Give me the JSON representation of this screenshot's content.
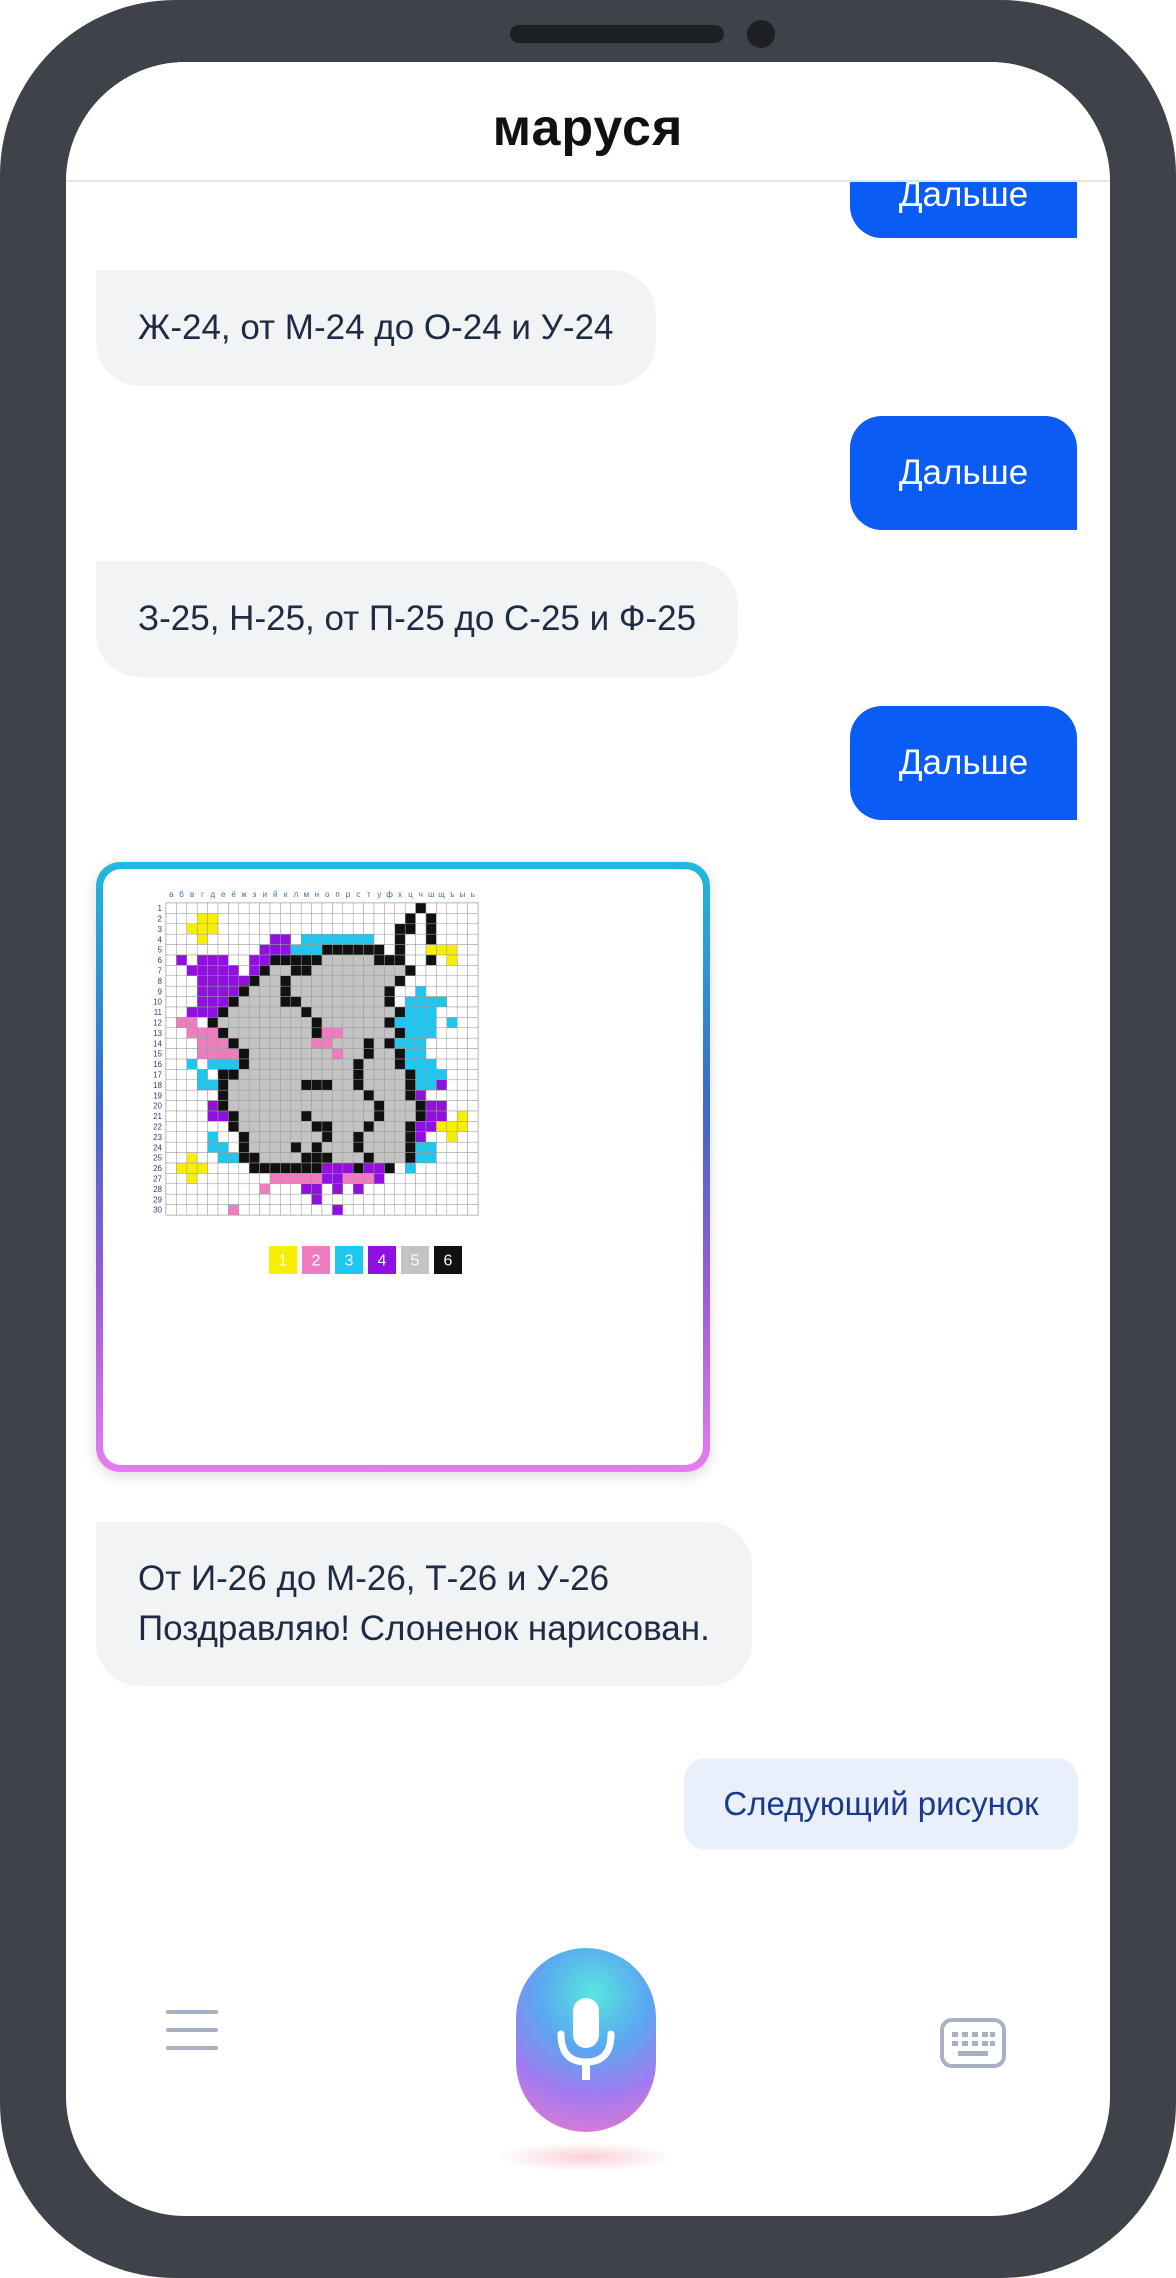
{
  "app": {
    "title": "маруся"
  },
  "messages": [
    {
      "from": "user",
      "text": "Дальше"
    },
    {
      "from": "assistant",
      "text": "Ж-24, от М-24 до О-24 и У-24"
    },
    {
      "from": "user",
      "text": "Дальше"
    },
    {
      "from": "assistant",
      "text": "З-25, Н-25, от П-25 до С-25 и Ф-25"
    },
    {
      "from": "user",
      "text": "Дальше"
    },
    {
      "from": "assistant",
      "lines": [
        "От И-26 до М-26, Т-26 и У-26",
        "Поздравляю! Слоненок нарисован."
      ]
    }
  ],
  "picture": {
    "column_letters": [
      "а",
      "б",
      "в",
      "г",
      "д",
      "е",
      "ё",
      "ж",
      "з",
      "и",
      "й",
      "к",
      "л",
      "м",
      "н",
      "о",
      "п",
      "р",
      "с",
      "т",
      "у",
      "ф",
      "х",
      "ц",
      "ч",
      "ш",
      "щ",
      "ъ",
      "ы",
      "ь"
    ],
    "row_numbers": [
      "1",
      "2",
      "3",
      "4",
      "5",
      "6",
      "7",
      "8",
      "9",
      "10",
      "11",
      "12",
      "13",
      "14",
      "15",
      "16",
      "17",
      "18",
      "19",
      "20",
      "21",
      "22",
      "23",
      "24",
      "25",
      "26",
      "27",
      "28",
      "29",
      "30"
    ],
    "palette": [
      {
        "label": "1",
        "color": "#f7ee00"
      },
      {
        "label": "2",
        "color": "#f07cc0"
      },
      {
        "label": "3",
        "color": "#1fc6ee"
      },
      {
        "label": "4",
        "color": "#9010e0"
      },
      {
        "label": "5",
        "color": "#c3c3c3"
      },
      {
        "label": "6",
        "color": "#111111"
      }
    ]
  },
  "suggestion": {
    "label": "Следующий рисунок"
  },
  "bottom_bar": {
    "menu_icon": "hamburger-menu-icon",
    "mic_icon": "microphone-icon",
    "keyboard_icon": "keyboard-icon"
  }
}
